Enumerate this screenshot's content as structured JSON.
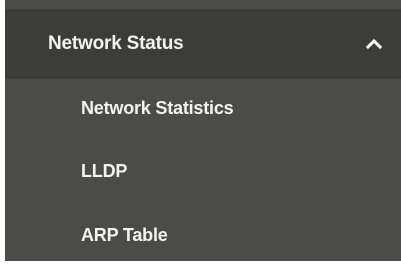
{
  "nav": {
    "section": {
      "label": "Network Status",
      "expanded": true,
      "toggle_icon": "chevron-up-icon"
    },
    "items": [
      {
        "label": "Network Statistics"
      },
      {
        "label": "LLDP"
      },
      {
        "label": "ARP Table"
      }
    ]
  },
  "colors": {
    "panel_background": "#4b4b48",
    "header_background": "#3c3d3a",
    "text": "#f1f1f1"
  }
}
